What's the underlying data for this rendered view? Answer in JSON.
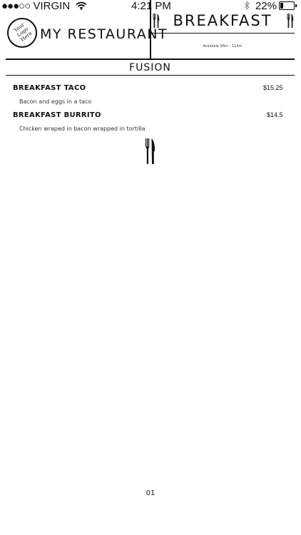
{
  "status_bar": {
    "signal": "●●●○○",
    "carrier": "VIRGIN",
    "time": "4:21 PM",
    "battery": "22%"
  },
  "header": {
    "logo_line1": "Your",
    "logo_line2": "Logo",
    "logo_line3": "Here",
    "restaurant_name": "MY RESTAURANT",
    "menu_title": "BREAKFAST",
    "availability": "Available 9Am - 11Am"
  },
  "section": {
    "title": "FUSION"
  },
  "items": [
    {
      "name": "BREAKFAST TACO",
      "price": "$15.25",
      "description": "Bacon and eggs in a taco"
    },
    {
      "name": "BREAKFAST BURRITO",
      "price": "$14.5",
      "description": "Chicken wraped in bacon wrapped in tortilla"
    }
  ],
  "footer": {
    "page_number": "01"
  },
  "icons": [
    "wifi-icon",
    "bluetooth-icon",
    "battery-icon",
    "fork-knife-icon",
    "utensils-divider-icon"
  ]
}
